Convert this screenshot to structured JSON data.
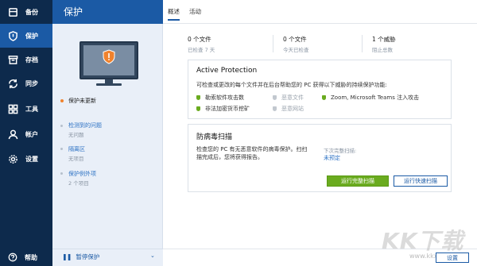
{
  "nav": {
    "items": [
      {
        "label": "备份",
        "icon": "archive-icon"
      },
      {
        "label": "保护",
        "icon": "shield-icon"
      },
      {
        "label": "存档",
        "icon": "box-icon"
      },
      {
        "label": "同步",
        "icon": "sync-icon"
      },
      {
        "label": "工具",
        "icon": "grid-icon"
      },
      {
        "label": "帐户",
        "icon": "user-icon"
      },
      {
        "label": "设置",
        "icon": "gear-icon"
      }
    ],
    "help_label": "帮助"
  },
  "middle": {
    "title": "保护",
    "status": "保护未更新",
    "detected_link": "检测到的问题",
    "detected_value": "无问题",
    "quarantine_link": "隔离区",
    "quarantine_value": "无项目",
    "exclusions_link": "保护例外项",
    "exclusions_value": "2 个项目",
    "pause_label": "暂停保护"
  },
  "tabs": [
    "概述",
    "活动"
  ],
  "stats": [
    {
      "main": "0 个文件",
      "sub": "已检查 7 天"
    },
    {
      "main": "0 个文件",
      "sub": "今天已检查"
    },
    {
      "main": "1 个威胁",
      "sub": "阻止总数"
    }
  ],
  "active_protection": {
    "title": "Active Protection",
    "description": "可检查或更改的每个文件并在后台帮助您的 PC 获得以下威胁的持续保护功能:",
    "features": [
      {
        "label": "勒索软件攻击数",
        "enabled": true
      },
      {
        "label": "非法加密货币挖矿",
        "enabled": true
      },
      {
        "label": "恶意文件",
        "enabled": false
      },
      {
        "label": "恶意网站",
        "enabled": false
      },
      {
        "label": "Zoom, Microsoft Teams 注入攻击",
        "enabled": true
      }
    ]
  },
  "antivirus": {
    "title": "防病毒扫描",
    "description_line1": "检查您的 PC 有无恶意软件的病毒保护。扫扫",
    "description_line2": "描完成后，您将获得报告。",
    "next_full_scan_label": "下次完整扫描:",
    "next_full_scan_value": "未预定",
    "full_scan_button": "运行完整扫描",
    "quick_scan_button": "运行快速扫描"
  },
  "footer": {
    "settings_button": "设置"
  },
  "watermark": {
    "text": "KK下载",
    "url": "www.kkx.net"
  },
  "colors": {
    "nav_bg": "#0d2a4c",
    "accent": "#1b5aa5",
    "green": "#6aab1f",
    "warning": "#f0822d"
  }
}
